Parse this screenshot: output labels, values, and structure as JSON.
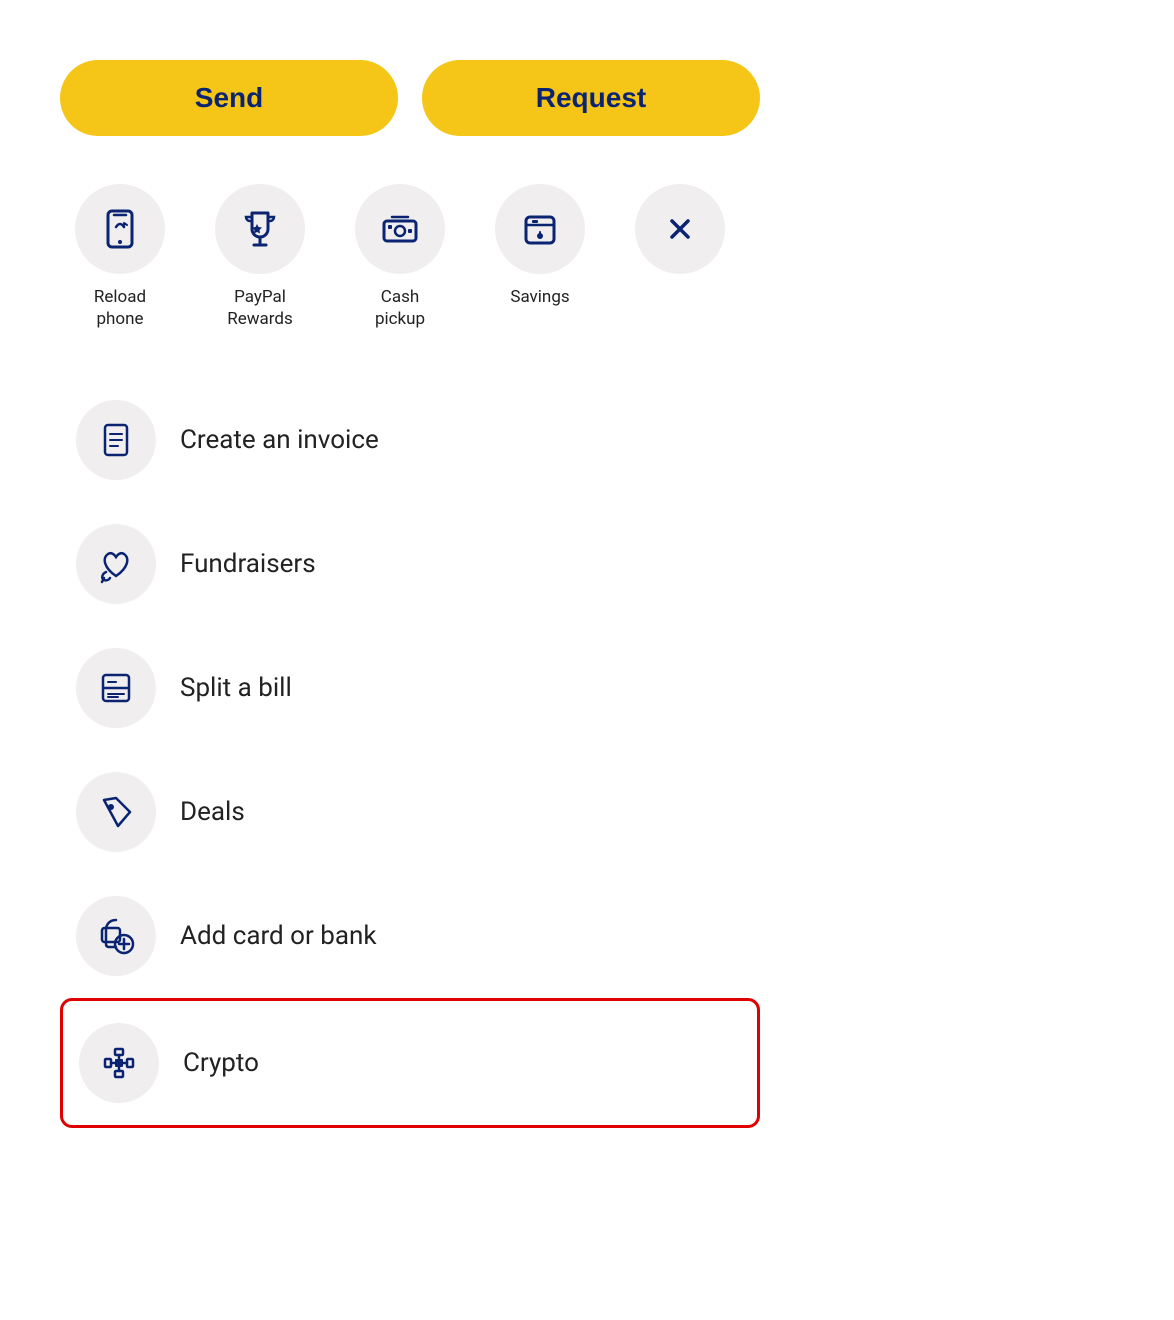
{
  "buttons": {
    "send_label": "Send",
    "request_label": "Request"
  },
  "quick_actions": [
    {
      "id": "reload-phone",
      "label": "Reload\nphone",
      "icon": "reload-phone-icon"
    },
    {
      "id": "paypal-rewards",
      "label": "PayPal\nRewards",
      "icon": "trophy-icon"
    },
    {
      "id": "cash-pickup",
      "label": "Cash\npickup",
      "icon": "cash-pickup-icon"
    },
    {
      "id": "savings",
      "label": "Savings",
      "icon": "savings-icon"
    },
    {
      "id": "close",
      "label": "",
      "icon": "close-icon"
    }
  ],
  "list_items": [
    {
      "id": "create-invoice",
      "label": "Create an invoice",
      "icon": "invoice-icon",
      "highlighted": false
    },
    {
      "id": "fundraisers",
      "label": "Fundraisers",
      "icon": "fundraisers-icon",
      "highlighted": false
    },
    {
      "id": "split-bill",
      "label": "Split a bill",
      "icon": "split-bill-icon",
      "highlighted": false
    },
    {
      "id": "deals",
      "label": "Deals",
      "icon": "deals-icon",
      "highlighted": false
    },
    {
      "id": "add-card-bank",
      "label": "Add card or bank",
      "icon": "add-card-icon",
      "highlighted": false
    },
    {
      "id": "crypto",
      "label": "Crypto",
      "icon": "crypto-icon",
      "highlighted": true
    }
  ],
  "colors": {
    "accent_yellow": "#F5C518",
    "brand_blue": "#0a2472",
    "icon_bg": "#f0eeee",
    "text_primary": "#222222",
    "highlight_border": "#e00000"
  }
}
